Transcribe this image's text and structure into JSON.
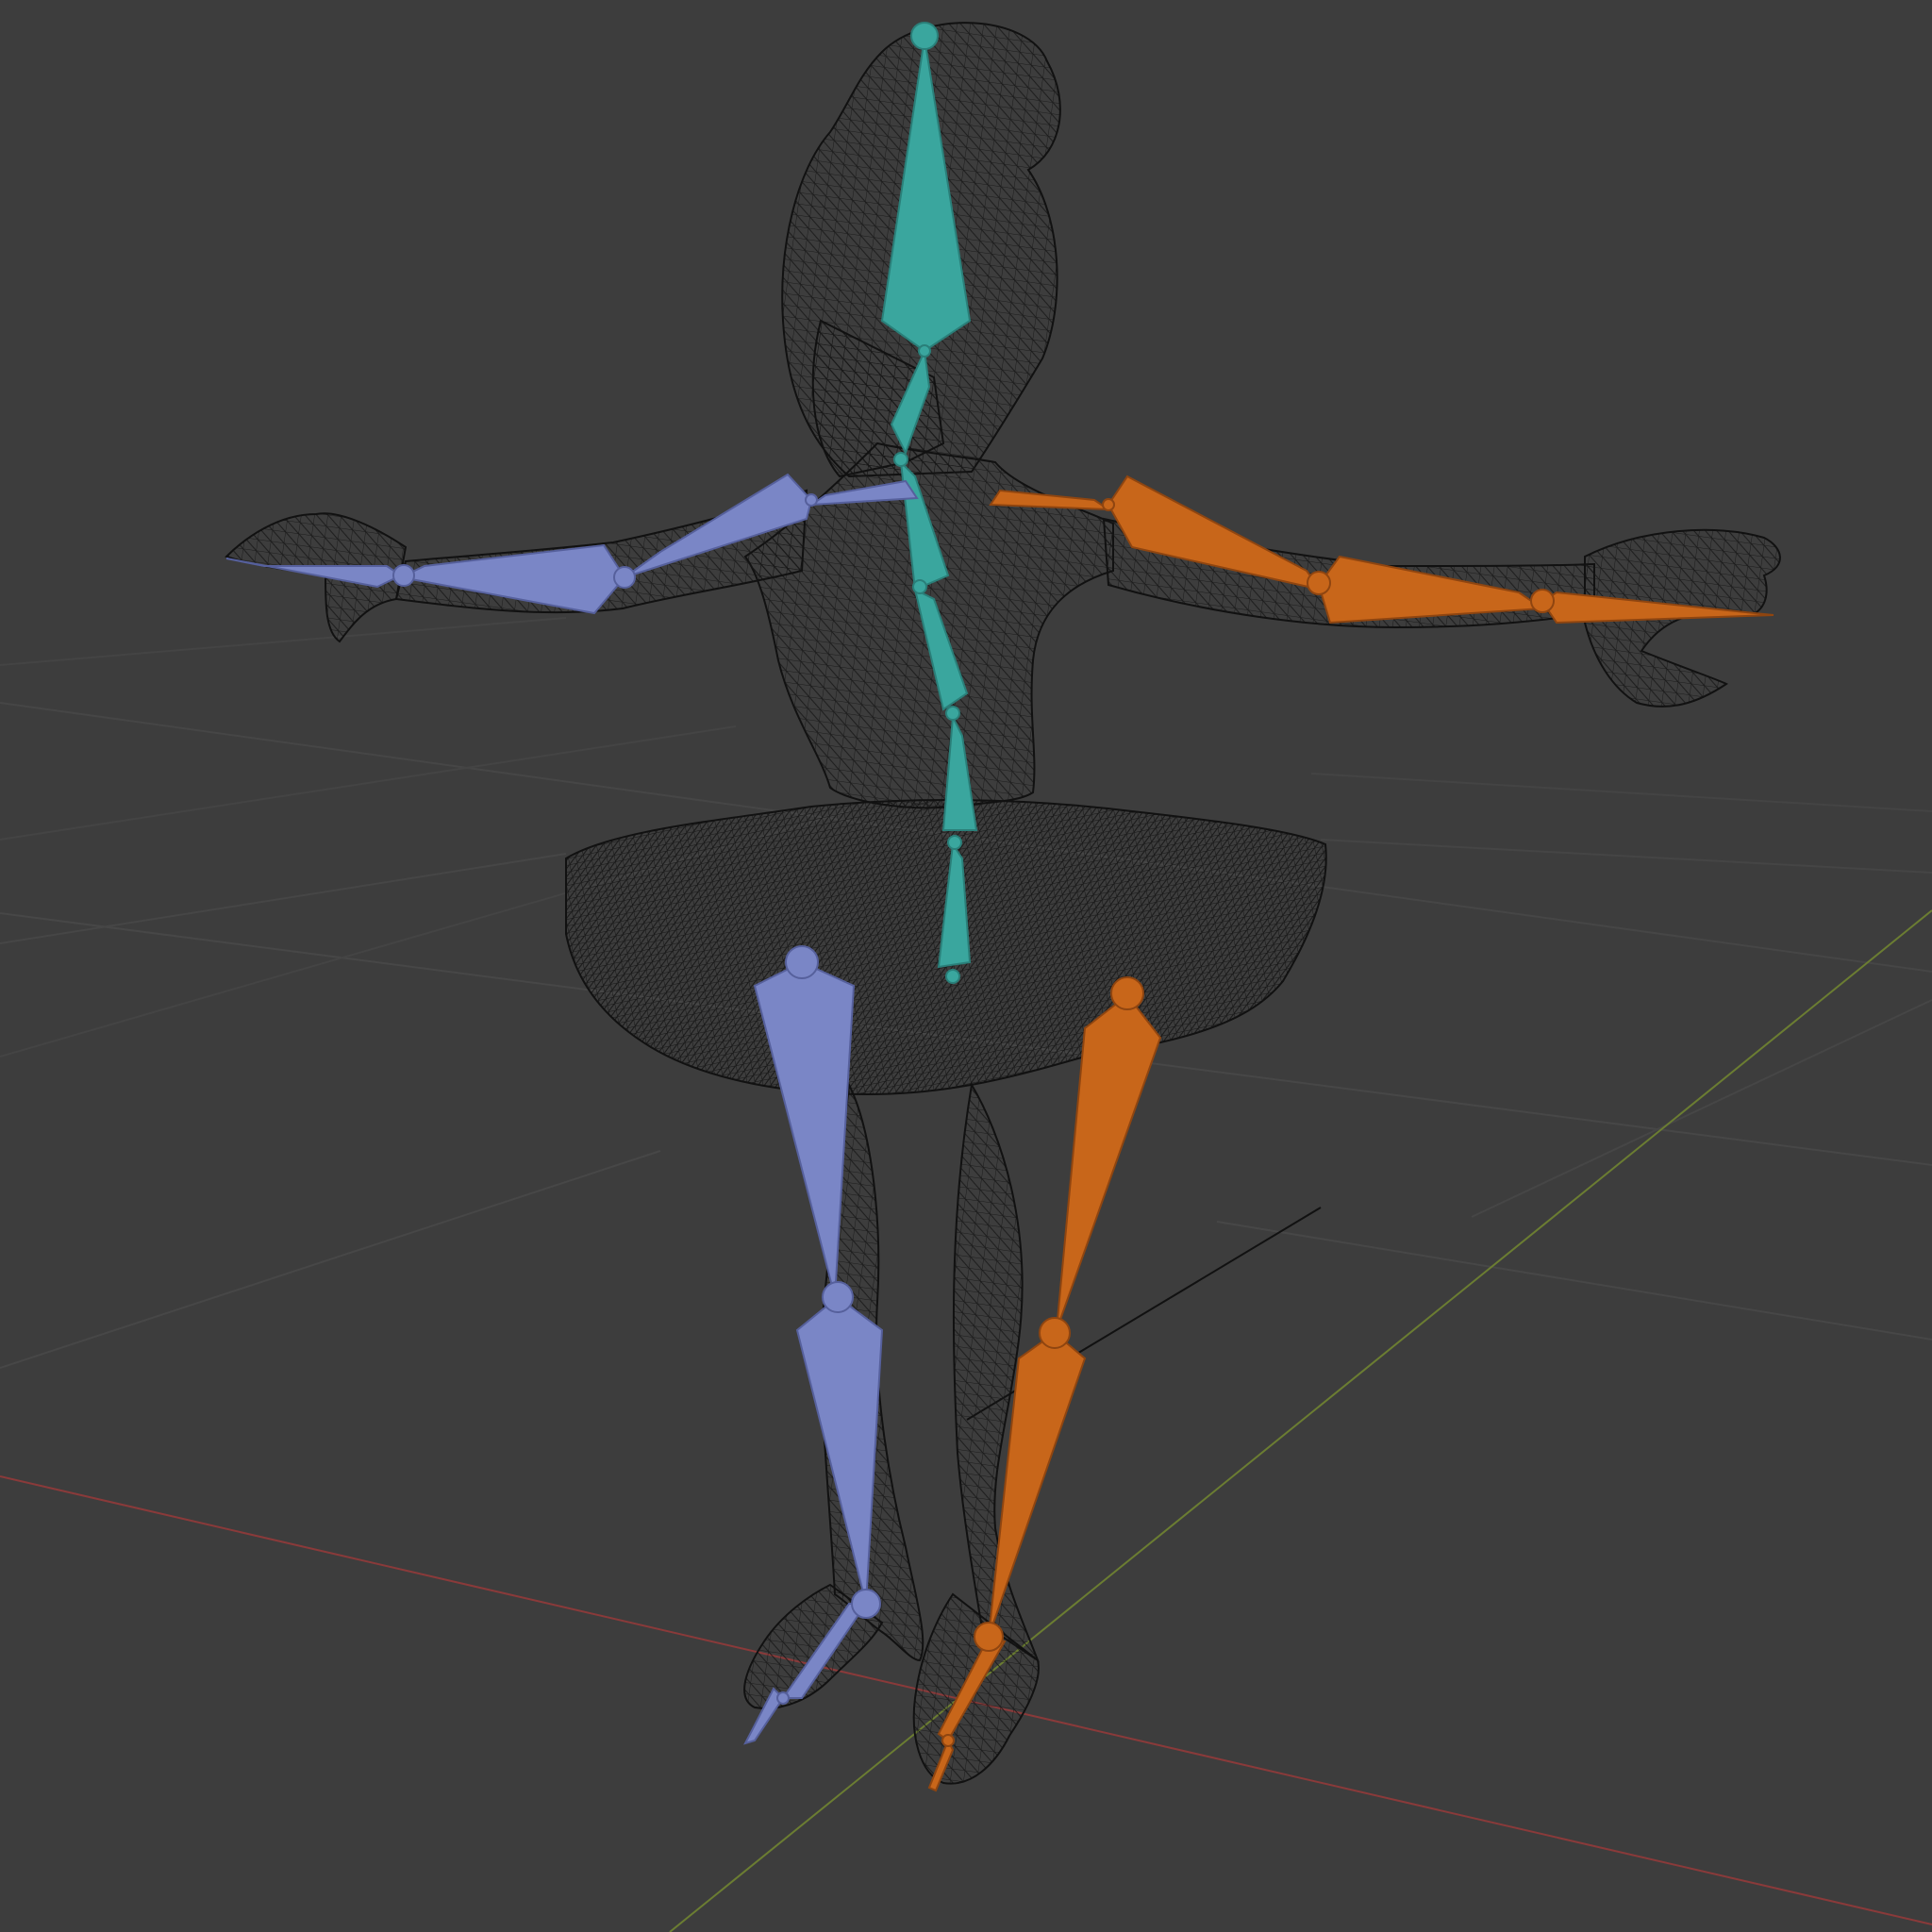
{
  "viewport": {
    "background": "#3d3d3d",
    "grid_color": "#4a4a4a",
    "x_axis_color": "#8a3a3a",
    "y_axis_color": "#6b7d32"
  },
  "armature": {
    "center_bone_color": "#3aa69e",
    "left_side_color": "#7a86c6",
    "right_side_color": "#c8661a"
  },
  "mesh": {
    "display": "wireframe",
    "wire_color": "#0f0f0f"
  }
}
